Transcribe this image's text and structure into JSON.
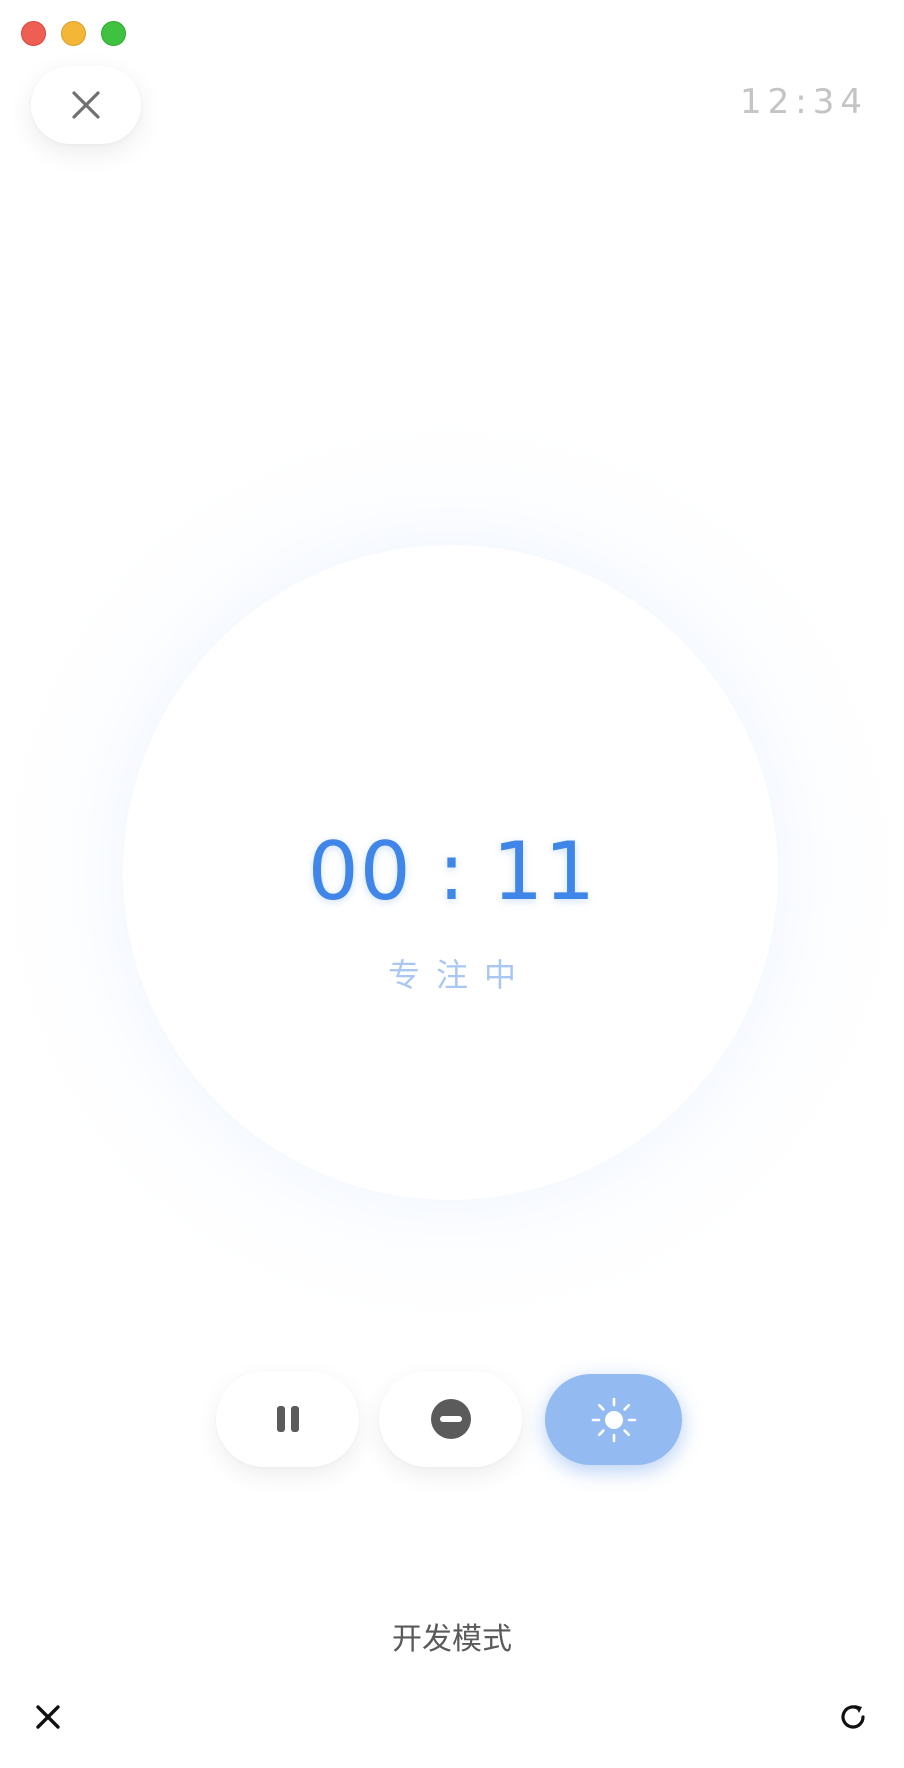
{
  "window": {
    "controls": [
      "close",
      "minimize",
      "maximize"
    ]
  },
  "header": {
    "close_icon": "close-icon",
    "clock": "12:34"
  },
  "timer": {
    "time": "00 : 11",
    "status": "专注中"
  },
  "controls": {
    "pause_icon": "pause-icon",
    "dnd_icon": "do-not-disturb-icon",
    "light_icon": "sun-icon"
  },
  "footer": {
    "mode_label": "开发模式",
    "close_icon": "close-icon",
    "refresh_icon": "refresh-icon"
  },
  "colors": {
    "accent": "#3f86e8",
    "accent_light": "#93baf1",
    "status": "#a9c7f2"
  }
}
